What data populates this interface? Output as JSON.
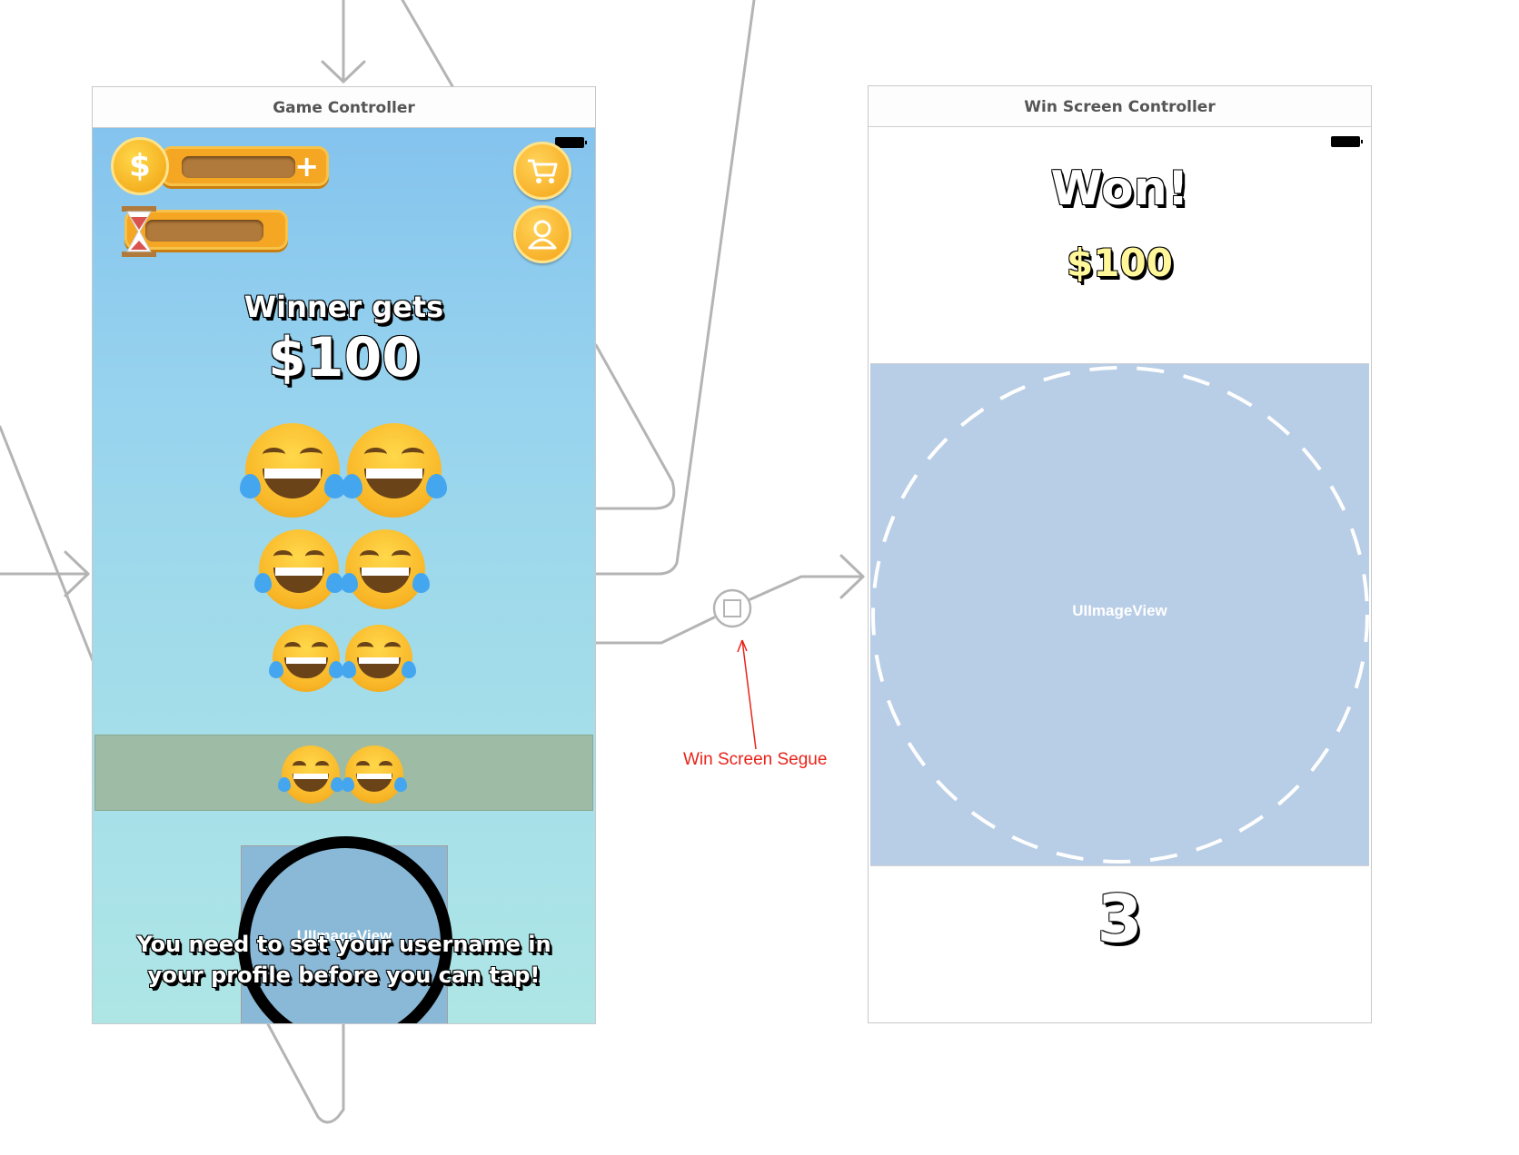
{
  "game_controller": {
    "title": "Game Controller",
    "winner_label": "Winner gets",
    "prize": "$100",
    "plus": "+",
    "image_placeholder": "UIImageView",
    "username_warning": "You need to set your username in your profile before you can tap!",
    "icons": [
      "coin-icon",
      "hourglass-icon",
      "cart-icon",
      "profile-icon",
      "laughing-emoji-icon"
    ]
  },
  "win_screen_controller": {
    "title": "Win Screen Controller",
    "won_label": "Won!",
    "prize": "$100",
    "image_placeholder": "UIImageView",
    "countdown": "3"
  },
  "segue": {
    "label": "Win Screen Segue",
    "colors": {
      "annotation": "#e8231a",
      "connector": "#b4b4b4"
    }
  }
}
